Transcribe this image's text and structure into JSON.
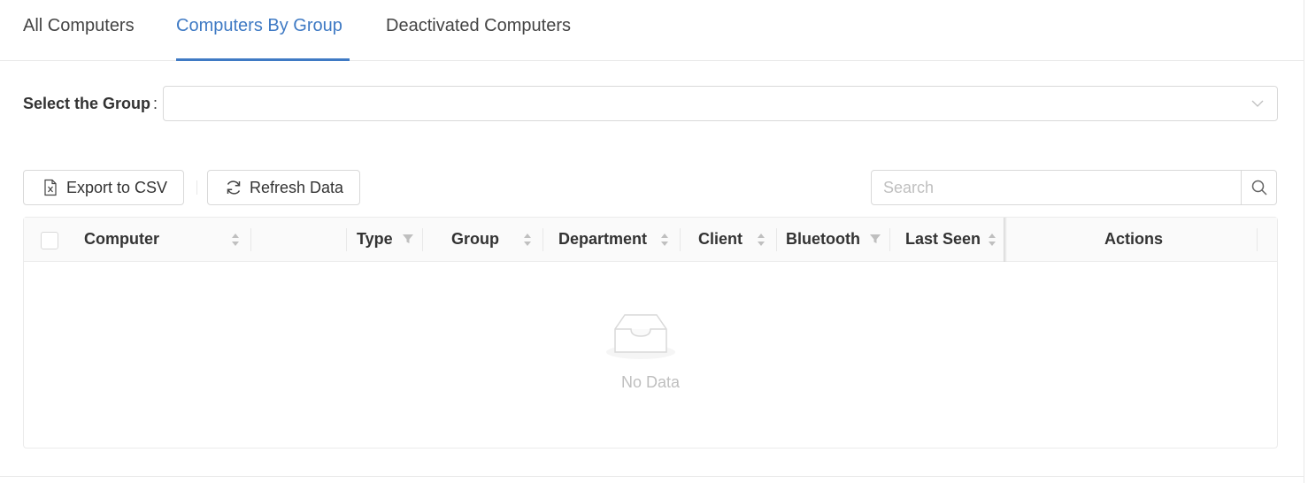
{
  "tabs": [
    {
      "label": "All Computers",
      "active": false
    },
    {
      "label": "Computers By Group",
      "active": true
    },
    {
      "label": "Deactivated Computers",
      "active": false
    }
  ],
  "group_select": {
    "label": "Select the Group",
    "colon": ":",
    "value": ""
  },
  "toolbar": {
    "export_label": "Export to CSV",
    "refresh_label": "Refresh Data"
  },
  "search": {
    "placeholder": "Search"
  },
  "table": {
    "columns": {
      "computer": "Computer",
      "type": "Type",
      "group": "Group",
      "department": "Department",
      "client": "Client",
      "bluetooth": "Bluetooth",
      "last_seen": "Last Seen",
      "actions": "Actions"
    },
    "rows": [],
    "empty_text": "No Data"
  },
  "colors": {
    "accent": "#3f7ac4",
    "border": "#d9d9d9",
    "header_bg": "#fafafa",
    "muted": "#bfbfbf"
  },
  "icons": {
    "export": "excel-file-icon",
    "refresh": "refresh-icon",
    "search": "search-icon",
    "select": "chevron-down-icon",
    "sort": "sort-icon",
    "filter": "filter-icon",
    "empty": "empty-inbox-icon"
  }
}
